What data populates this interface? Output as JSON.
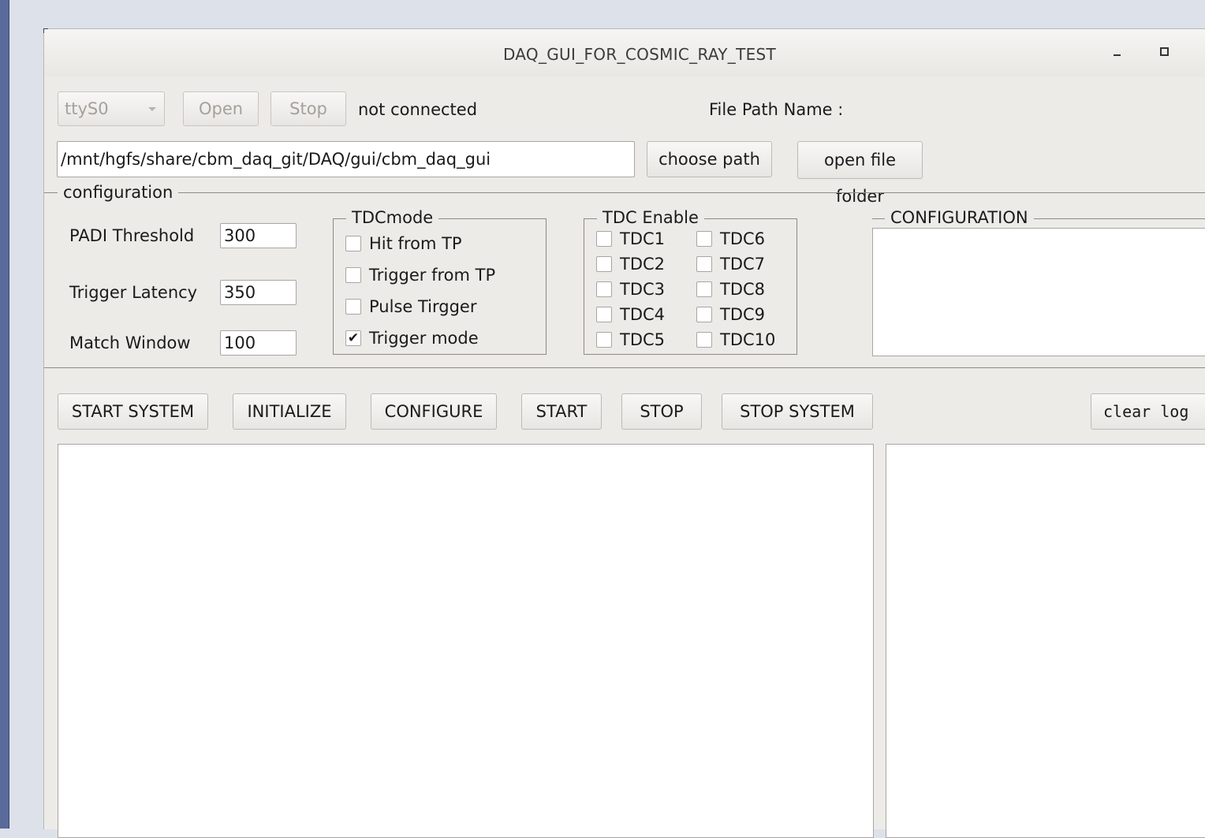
{
  "window": {
    "title": "DAQ_GUI_FOR_COSMIC_RAY_TEST",
    "minimize_symbol": "_",
    "maximize_icon": "maximize-icon"
  },
  "connection": {
    "port_value": "ttyS0",
    "open_label": "Open",
    "stop_label": "Stop",
    "status_text": "not connected",
    "file_path_label": "File Path Name :"
  },
  "path": {
    "value": "/mnt/hgfs/share/cbm_daq_git/DAQ/gui/cbm_daq_gui",
    "choose_label": "choose path",
    "open_folder_label": "open file folder"
  },
  "configuration": {
    "group_title": "configuration",
    "padi_label": "PADI Threshold",
    "padi_value": "300",
    "latency_label": "Trigger Latency",
    "latency_value": "350",
    "window_label": "Match Window",
    "window_value": "100",
    "tdcmode": {
      "title": "TDCmode",
      "options": [
        {
          "label": "Hit from TP",
          "checked": false
        },
        {
          "label": "Trigger from TP",
          "checked": false
        },
        {
          "label": "Pulse Tirgger",
          "checked": false
        },
        {
          "label": "Trigger mode",
          "checked": true
        }
      ]
    },
    "tdc_enable": {
      "title": "TDC Enable",
      "items": [
        "TDC1",
        "TDC2",
        "TDC3",
        "TDC4",
        "TDC5",
        "TDC6",
        "TDC7",
        "TDC8",
        "TDC9",
        "TDC10"
      ]
    },
    "config_box_title": "CONFIGURATION"
  },
  "controls": {
    "start_system": "START SYSTEM",
    "initialize": "INITIALIZE",
    "configure": "CONFIGURE",
    "start": "START",
    "stop": "STOP",
    "stop_system": "STOP SYSTEM",
    "clear_log": "clear log"
  },
  "checkmark": "✔"
}
